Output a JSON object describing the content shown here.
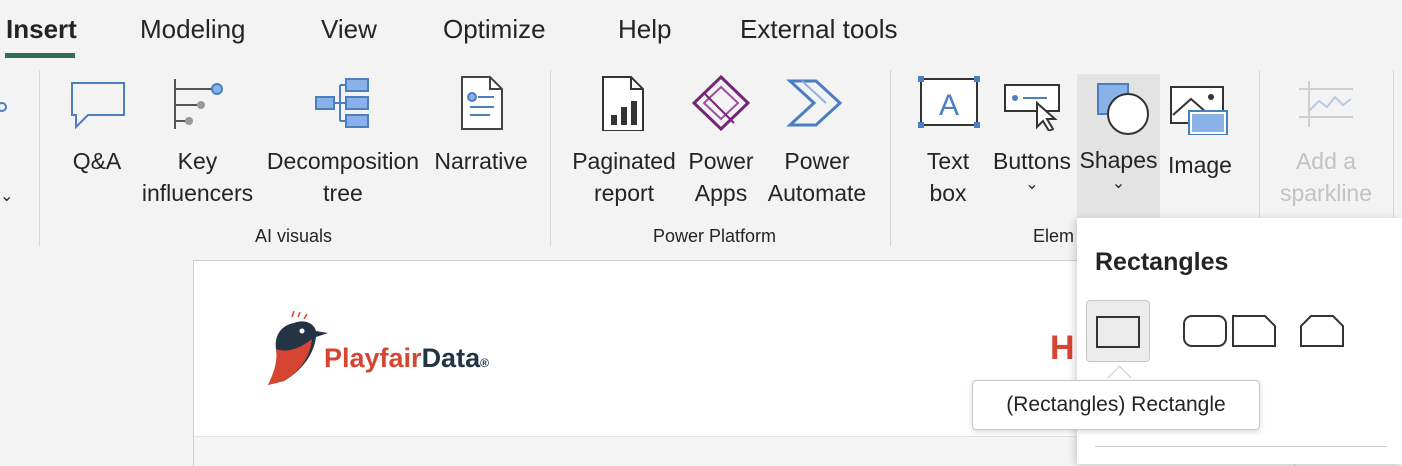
{
  "tabs": {
    "insert": "Insert",
    "modeling": "Modeling",
    "view": "View",
    "optimize": "Optimize",
    "help": "Help",
    "external_tools": "External tools"
  },
  "ribbon": {
    "ai_visuals": {
      "label": "AI visuals",
      "qa": "Q&A",
      "key_influencers": "Key\ninfluencers",
      "decomposition_tree": "Decomposition\ntree",
      "narrative": "Narrative"
    },
    "power_platform": {
      "label": "Power Platform",
      "paginated_report": "Paginated\nreport",
      "power_apps": "Power\nApps",
      "power_automate": "Power\nAutomate"
    },
    "elements": {
      "label": "Elem",
      "text_box": "Text\nbox",
      "buttons": "Buttons",
      "shapes": "Shapes",
      "image": "Image"
    },
    "sparklines": {
      "add_sparkline": "Add a\nsparkline"
    },
    "chevron": "⌄"
  },
  "canvas": {
    "logo_part1": "Playfair",
    "logo_part2": "Data",
    "logo_reg": "®",
    "partial_heading": "H"
  },
  "shapes_dropdown": {
    "title": "Rectangles",
    "items": [
      "Rectangle",
      "Rounded rectangle",
      "Snip corner rectangle",
      "Snip top corners rectangle"
    ],
    "tooltip": "(Rectangles) Rectangle"
  },
  "colors": {
    "accent": "#2f6e55",
    "icon_blue": "#4a7fc1",
    "icon_purple": "#742774",
    "icon_light_blue": "#8bb2e8",
    "brand_red": "#d64532",
    "brand_navy": "#253445"
  }
}
